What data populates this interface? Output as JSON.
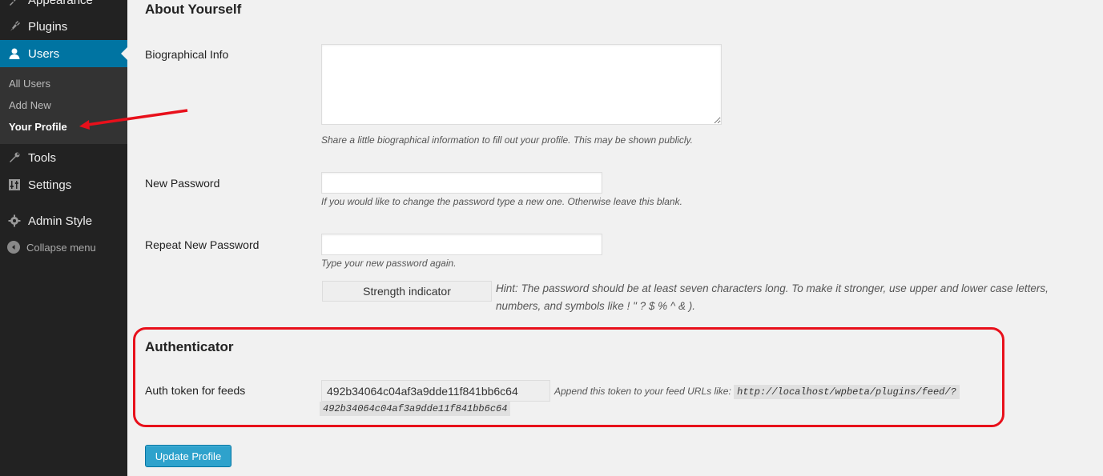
{
  "sidebar": {
    "appearance_label": "Appearance",
    "plugins_label": "Plugins",
    "users_label": "Users",
    "submenu": {
      "all_users": "All Users",
      "add_new": "Add New",
      "your_profile": "Your Profile"
    },
    "tools_label": "Tools",
    "settings_label": "Settings",
    "admin_style_label": "Admin Style",
    "collapse_label": "Collapse menu"
  },
  "about": {
    "title": "About Yourself",
    "bio_label": "Biographical Info",
    "bio_value": "",
    "bio_desc": "Share a little biographical information to fill out your profile. This may be shown publicly.",
    "new_password_label": "New Password",
    "new_password_value": "",
    "new_password_desc": "If you would like to change the password type a new one. Otherwise leave this blank.",
    "repeat_password_label": "Repeat New Password",
    "repeat_password_value": "",
    "repeat_password_desc": "Type your new password again.",
    "strength_label": "Strength indicator",
    "hint": "Hint: The password should be at least seven characters long. To make it stronger, use upper and lower case letters, numbers, and symbols like ! \" ? $ % ^ & )."
  },
  "authenticator": {
    "title": "Authenticator",
    "token_label": "Auth token for feeds",
    "token_value": "492b34064c04af3a9dde11f841bb6c64",
    "append_text": "Append this token to your feed URLs like:",
    "feed_url": "http://localhost/wpbeta/plugins/feed/?",
    "feed_token": "492b34064c04af3a9dde11f841bb6c64"
  },
  "update_button": "Update Profile",
  "colors": {
    "sidebar_bg": "#222222",
    "active_menu": "#0074a2",
    "button": "#2ea2cc",
    "highlight": "#e8101b"
  }
}
